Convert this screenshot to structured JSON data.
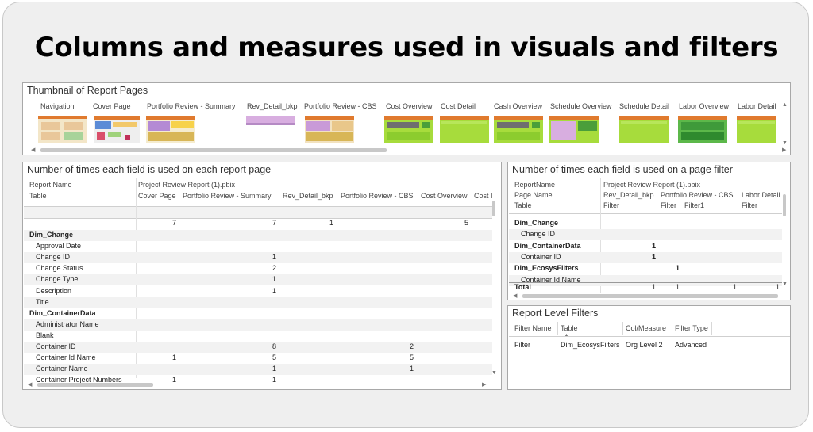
{
  "title": "Columns and measures used in visuals and filters",
  "thumbnails": {
    "title": "Thumbnail of Report Pages",
    "pages": [
      "Navigation",
      "Cover Page",
      "Portfolio Review - Summary",
      "Rev_Detail_bkp",
      "Portfolio Review - CBS",
      "Cost Overview",
      "Cost Detail",
      "Cash Overview",
      "Schedule Overview",
      "Schedule Detail",
      "Labor Overview",
      "Labor Detail"
    ]
  },
  "usage": {
    "title": "Number of times each field is used on each report page",
    "header": {
      "report_name_label": "Report Name",
      "table_label": "Table",
      "report_name": "Project Review Report (1).pbix",
      "columns": [
        "Cover Page",
        "Portfolio Review - Summary",
        "Rev_Detail_bkp",
        "Portfolio Review - CBS",
        "Cost Overview",
        "Cost I"
      ]
    },
    "totals": [
      "7",
      "7",
      "1",
      "",
      "5"
    ],
    "rows": [
      {
        "label": "Dim_Change",
        "bold": true,
        "values": [
          "",
          "",
          "",
          "",
          ""
        ]
      },
      {
        "label": "Approval Date",
        "bold": false,
        "values": [
          "",
          "",
          "",
          "",
          ""
        ]
      },
      {
        "label": "Change ID",
        "bold": false,
        "values": [
          "",
          "1",
          "",
          "",
          ""
        ]
      },
      {
        "label": "Change Status",
        "bold": false,
        "values": [
          "",
          "2",
          "",
          "",
          ""
        ]
      },
      {
        "label": "Change Type",
        "bold": false,
        "values": [
          "",
          "1",
          "",
          "",
          ""
        ]
      },
      {
        "label": "Description",
        "bold": false,
        "values": [
          "",
          "1",
          "",
          "",
          ""
        ]
      },
      {
        "label": "Title",
        "bold": false,
        "values": [
          "",
          "",
          "",
          "",
          ""
        ]
      },
      {
        "label": "Dim_ContainerData",
        "bold": true,
        "values": [
          "",
          "",
          "",
          "",
          ""
        ]
      },
      {
        "label": "Administrator Name",
        "bold": false,
        "values": [
          "",
          "",
          "",
          "",
          ""
        ]
      },
      {
        "label": "Blank",
        "bold": false,
        "values": [
          "",
          "",
          "",
          "",
          ""
        ]
      },
      {
        "label": "Container ID",
        "bold": false,
        "values": [
          "",
          "8",
          "",
          "2",
          ""
        ]
      },
      {
        "label": "Container Id Name",
        "bold": false,
        "values": [
          "1",
          "5",
          "",
          "5",
          ""
        ]
      },
      {
        "label": "Container Name",
        "bold": false,
        "values": [
          "",
          "1",
          "",
          "1",
          ""
        ]
      },
      {
        "label": "Container Project Numbers",
        "bold": false,
        "values": [
          "1",
          "1",
          "",
          "",
          ""
        ]
      }
    ]
  },
  "filters": {
    "title": "Number of times each field is used on a page filter",
    "header": {
      "report_name_label": "ReportName",
      "page_name_label": "Page Name",
      "table_label": "Table",
      "report_name": "Project Review Report (1).pbix",
      "pages": [
        "Rev_Detail_bkp",
        "Portfolio Review - CBS",
        "Labor Detail"
      ],
      "subcols": [
        "Filter",
        "Filter",
        "Filter1",
        "Filter"
      ]
    },
    "rows": [
      {
        "label": "Dim_Change",
        "bold": true,
        "values": [
          "",
          "",
          "",
          ""
        ]
      },
      {
        "label": "Change ID",
        "bold": false,
        "values": [
          "",
          "",
          "",
          ""
        ]
      },
      {
        "label": "Dim_ContainerData",
        "bold": true,
        "values": [
          "1",
          "",
          "",
          ""
        ]
      },
      {
        "label": "Container ID",
        "bold": false,
        "values": [
          "1",
          "",
          "",
          ""
        ]
      },
      {
        "label": "Dim_EcosysFilters",
        "bold": true,
        "values": [
          "",
          "1",
          "",
          ""
        ]
      },
      {
        "label": "Container Id Name",
        "bold": false,
        "values": [
          "",
          "",
          "",
          ""
        ]
      }
    ],
    "total_label": "Total",
    "totals": [
      "1",
      "1",
      "1",
      "1"
    ]
  },
  "report_filters": {
    "title": "Report Level Filters",
    "columns": [
      "Filter Name",
      "Table",
      "Col/Measure",
      "Filter Type"
    ],
    "rows": [
      [
        "Filter",
        "Dim_EcosysFilters",
        "Org Level 2",
        "Advanced"
      ]
    ]
  }
}
